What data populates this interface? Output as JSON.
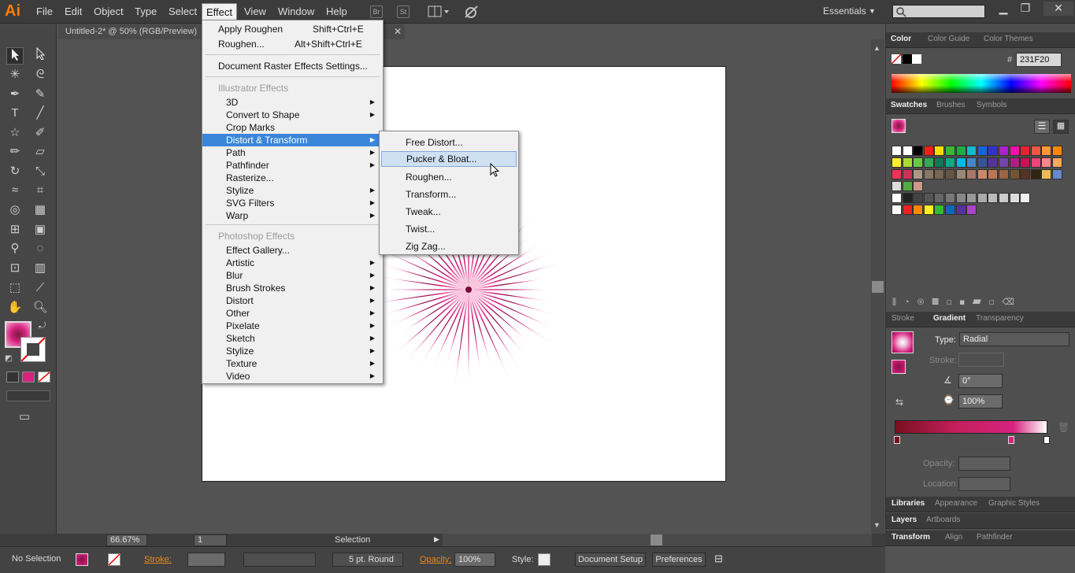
{
  "app": {
    "logo": "Ai"
  },
  "menubar": {
    "items": [
      "File",
      "Edit",
      "Object",
      "Type",
      "Select",
      "Effect",
      "View",
      "Window",
      "Help"
    ],
    "br_label": "Br",
    "st_label": "St",
    "workspace": "Essentials",
    "min": "▁",
    "max": "❐",
    "close": "✕"
  },
  "document": {
    "tab": "Untitled-2* @ 50% (RGB/Preview)",
    "close": "✕"
  },
  "effect_menu": {
    "apply_roughen": "Apply Roughen",
    "apply_roughen_sc": "Shift+Ctrl+E",
    "roughen": "Roughen...",
    "roughen_sc": "Alt+Shift+Ctrl+E",
    "doc_raster": "Document Raster Effects Settings...",
    "illustrator_header": "Illustrator Effects",
    "illustrator_items": [
      "3D",
      "Convert to Shape",
      "Crop Marks",
      "Distort & Transform",
      "Path",
      "Pathfinder",
      "Rasterize...",
      "Stylize",
      "SVG Filters",
      "Warp"
    ],
    "photoshop_header": "Photoshop Effects",
    "photoshop_items": [
      "Effect Gallery...",
      "Artistic",
      "Blur",
      "Brush Strokes",
      "Distort",
      "Other",
      "Pixelate",
      "Sketch",
      "Stylize",
      "Texture",
      "Video"
    ]
  },
  "submenu": {
    "items": [
      "Free Distort...",
      "Pucker & Bloat...",
      "Roughen...",
      "Transform...",
      "Tweak...",
      "Twist...",
      "Zig Zag..."
    ]
  },
  "color_panel": {
    "tabs": [
      "Color",
      "Color Guide",
      "Color Themes"
    ],
    "hex_label": "#",
    "hex": "231F20"
  },
  "swatches_panel": {
    "tabs": [
      "Swatches",
      "Brushes",
      "Symbols"
    ]
  },
  "gradient_panel": {
    "tabs": [
      "Stroke",
      "Gradient",
      "Transparency"
    ],
    "type_label": "Type:",
    "type_value": "Radial",
    "stroke_label": "Stroke:",
    "angle": "0°",
    "aspect": "100%",
    "opacity_label": "Opacity:",
    "location_label": "Location:"
  },
  "bottom_panels": {
    "row1": [
      "Libraries",
      "Appearance",
      "Graphic Styles"
    ],
    "row2": [
      "Layers",
      "Artboards"
    ],
    "row3": [
      "Transform",
      "Align",
      "Pathfinder"
    ]
  },
  "statusbar": {
    "zoom": "66.67%",
    "page": "1",
    "mode": "Selection"
  },
  "controlbar": {
    "selection": "No Selection",
    "stroke_label": "Stroke:",
    "brush": "5 pt. Round",
    "opacity_label": "Opacity:",
    "opacity": "100%",
    "style_label": "Style:",
    "doc_setup": "Document Setup",
    "preferences": "Preferences"
  },
  "colors": {
    "accent": "#3a86d8",
    "fill": "#d6237f",
    "logo": "#ff7c00"
  }
}
